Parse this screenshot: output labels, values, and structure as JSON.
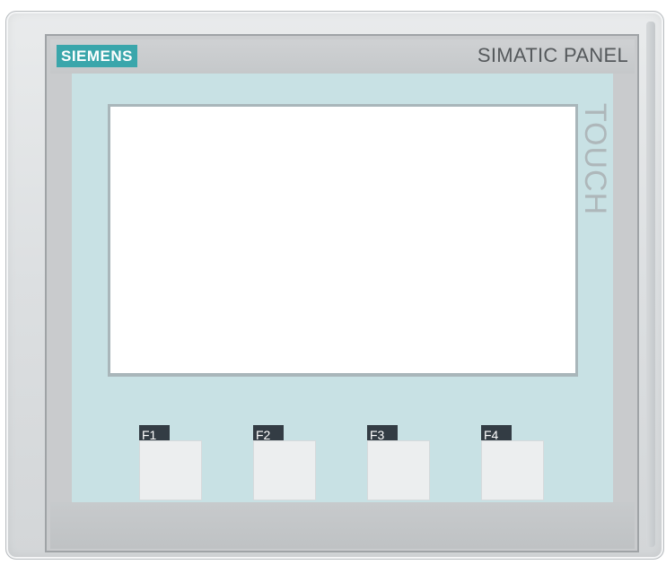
{
  "device": {
    "brand": "SIEMENS",
    "product_line": "SIMATIC PANEL",
    "touch_label": "TOUCH",
    "brand_color": "#3aa6ab",
    "membrane_color": "#c8e1e4"
  },
  "function_keys": [
    {
      "label": "F1"
    },
    {
      "label": "F2"
    },
    {
      "label": "F3"
    },
    {
      "label": "F4"
    }
  ]
}
